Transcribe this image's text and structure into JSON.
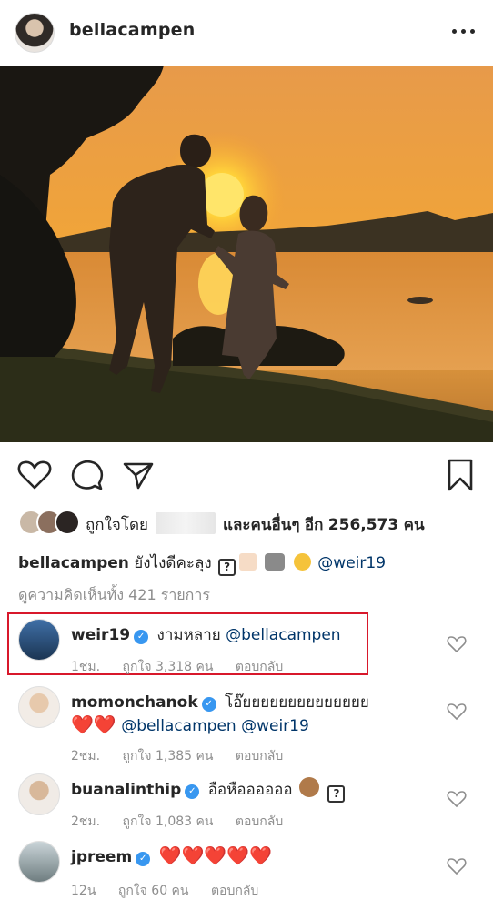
{
  "post": {
    "username": "bellacampen",
    "more_icon": "more-horizontal-icon"
  },
  "actions": {
    "like_icon": "heart-outline-icon",
    "comment_icon": "comment-icon",
    "share_icon": "paper-plane-icon",
    "save_icon": "bookmark-icon"
  },
  "likes": {
    "prefix": "ถูกใจโดย",
    "middle": "และคนอื่นๆ",
    "suffix_label": "อีก",
    "count": "256,573",
    "unit": "คน"
  },
  "caption": {
    "username": "bellacampen",
    "text": "ยังไงดีคะลุง",
    "mention": "@weir19"
  },
  "view_all_comments": "ดูความคิดเห็นทั้ง 421 รายการ",
  "comments": [
    {
      "username": "weir19",
      "text": "งามหลาย",
      "mention": "@bellacampen",
      "time": "1ชม.",
      "likes": "ถูกใจ 3,318 คน",
      "reply": "ตอบกลับ",
      "highlighted": true
    },
    {
      "username": "momonchanok",
      "text": "โอ๊ยยยยยยยยยยยยยย",
      "hearts": "❤️❤️",
      "mention": "@bellacampen @weir19",
      "time": "2ชม.",
      "likes": "ถูกใจ 1,385 คน",
      "reply": "ตอบกลับ"
    },
    {
      "username": "buanalinthip",
      "text": "อือหืออออออ",
      "time": "2ชม.",
      "likes": "ถูกใจ 1,083 คน",
      "reply": "ตอบกลับ"
    },
    {
      "username": "jpreem",
      "hearts": "❤️❤️❤️❤️❤️",
      "time": "12น",
      "likes": "ถูกใจ 60 คน",
      "reply": "ตอบกลับ"
    }
  ],
  "colors": {
    "text": "#262626",
    "muted": "#8e8e8e",
    "mention": "#003569",
    "verified": "#3897f0",
    "highlight": "#d8182b"
  }
}
